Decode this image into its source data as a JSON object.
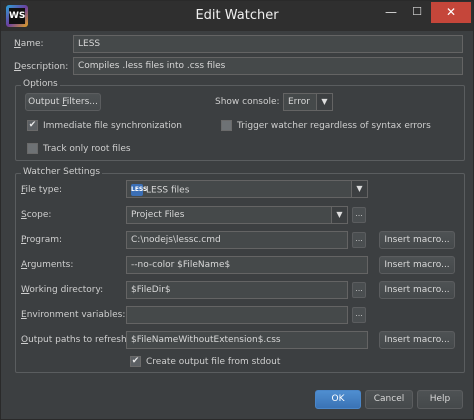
{
  "window": {
    "title": "Edit Watcher",
    "app_icon_text": "WS",
    "minimize_glyph": "—",
    "maximize_glyph": "☐",
    "close_glyph": "✕"
  },
  "name": {
    "label_u": "N",
    "label_rest": "ame:",
    "value": "LESS"
  },
  "description": {
    "label_u": "D",
    "label_rest": "escription:",
    "value": "Compiles .less files into .css files"
  },
  "options": {
    "legend": "Options",
    "output_filters_u": "Output ",
    "output_filters_key": "F",
    "output_filters_rest": "ilters...",
    "show_console_label": "Show console:",
    "show_console_value": "Error",
    "immediate_sync_label": "Immediate file synchronization",
    "immediate_sync_checked": true,
    "trigger_label": "Trigger watcher regardless of syntax errors",
    "trigger_checked": false,
    "track_root_label": "Track only root files",
    "track_root_checked": false
  },
  "watcher": {
    "legend": "Watcher Settings",
    "file_type": {
      "label_u": "F",
      "label_rest": "ile type:",
      "value": "LESS files",
      "icon": "less-file-icon",
      "icon_text": "LESS"
    },
    "scope": {
      "label_u": "S",
      "label_rest": "cope:",
      "value": "Project Files"
    },
    "program": {
      "label_u": "P",
      "label_rest": "rogram:",
      "value": "C:\\nodejs\\lessc.cmd"
    },
    "arguments": {
      "label_u": "A",
      "label_rest": "rguments:",
      "value": "--no-color $FileName$"
    },
    "working_dir": {
      "label_u": "W",
      "label_rest": "orking directory:",
      "value": "$FileDir$"
    },
    "env_vars": {
      "label_u": "E",
      "label_rest": "nvironment variables:",
      "value": ""
    },
    "output_paths": {
      "label_u": "O",
      "label_rest": "utput paths to refresh:",
      "value": "$FileNameWithoutExtension$.css"
    },
    "create_output_label": "Create output file from stdout",
    "create_output_checked": true,
    "insert_macro": "Insert macro...",
    "ellipsis": "..."
  },
  "footer": {
    "ok": "OK",
    "cancel": "Cancel",
    "help": "Help"
  }
}
